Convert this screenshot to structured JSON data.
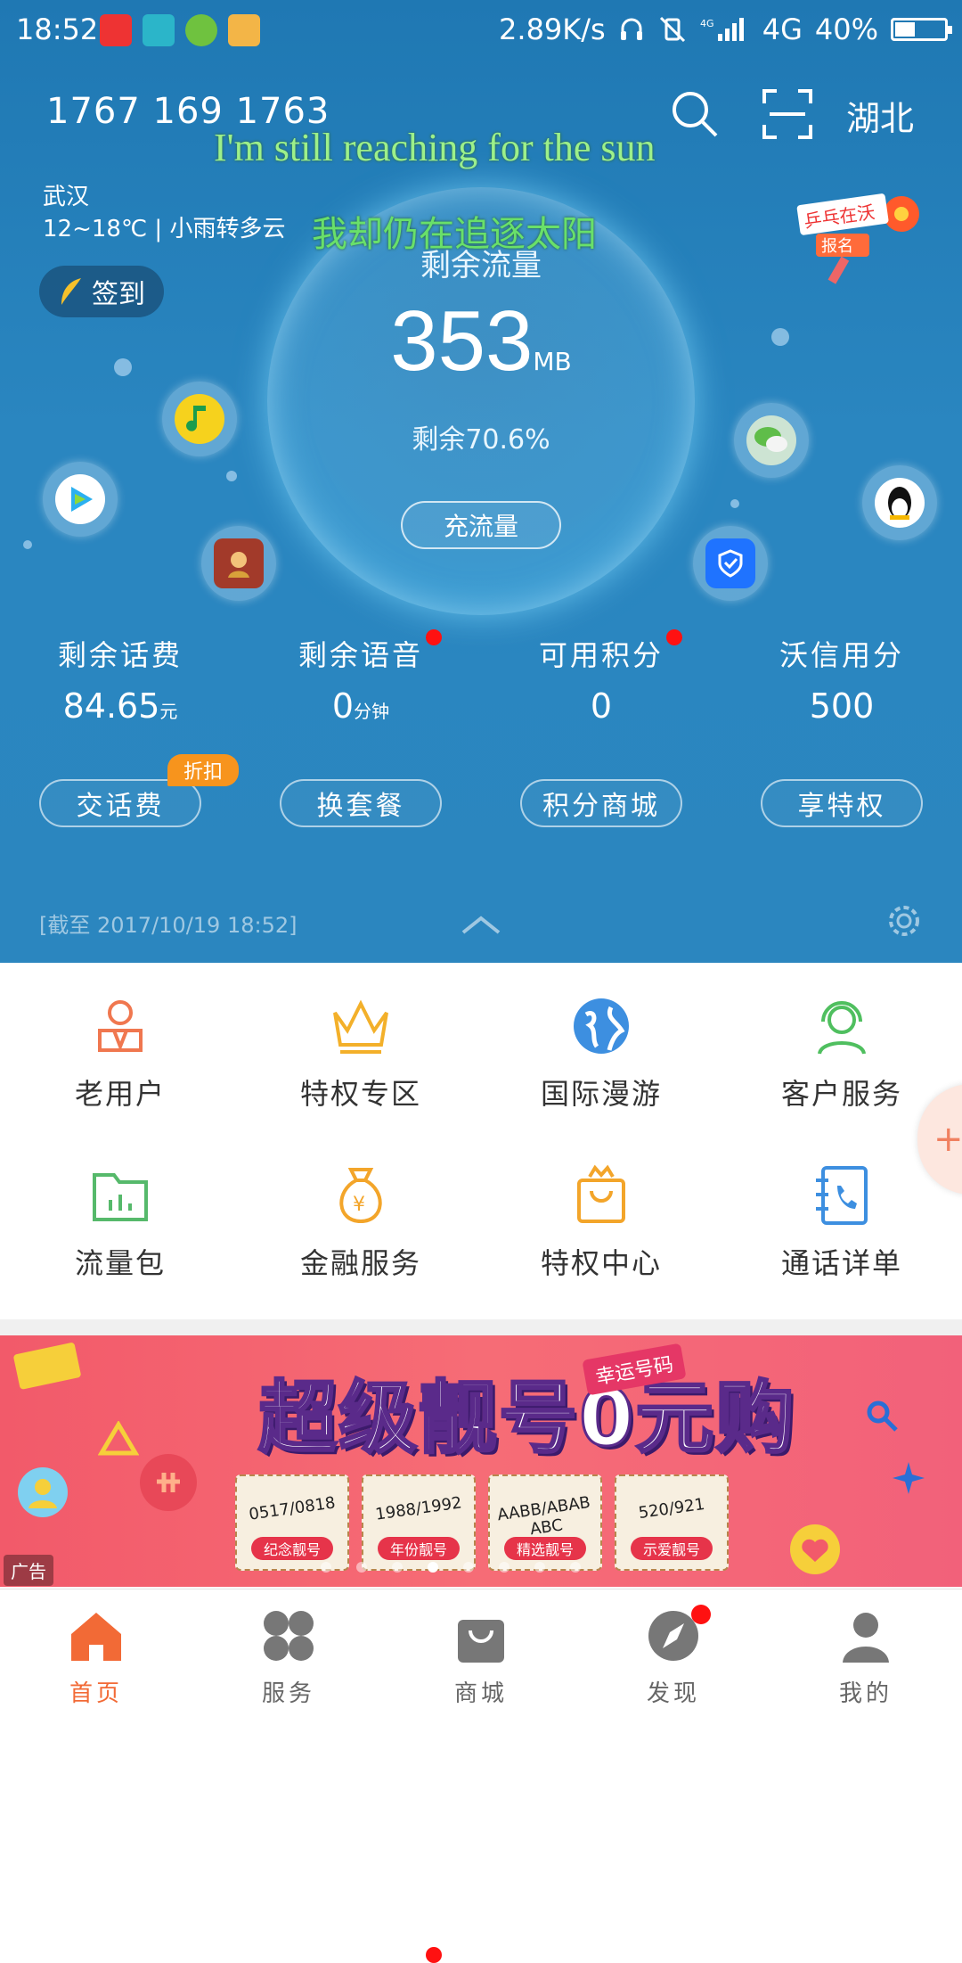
{
  "status": {
    "time": "18:52",
    "net_speed": "2.89K/s",
    "network": "4G",
    "battery": "40%",
    "battery_level": 0.4
  },
  "header": {
    "phone": "1767 169 1763",
    "region": "湖北"
  },
  "lyrics": {
    "line1": "I'm still reaching for the sun",
    "line2": "我却仍在追逐太阳"
  },
  "weather": {
    "city": "武汉",
    "detail": "12~18℃ | 小雨转多云"
  },
  "signin": {
    "label": "签到"
  },
  "bubble": {
    "label": "剩余流量",
    "value": "353",
    "unit": "MB",
    "percent_text": "剩余70.6%",
    "recharge_label": "充流量"
  },
  "stats": [
    {
      "label": "剩余话费",
      "value": "84.65",
      "unit": "元"
    },
    {
      "label": "剩余语音",
      "value": "0",
      "unit": "分钟"
    },
    {
      "label": "可用积分",
      "value": "0",
      "unit": ""
    },
    {
      "label": "沃信用分",
      "value": "500",
      "unit": ""
    }
  ],
  "actions": [
    {
      "label": "交话费"
    },
    {
      "label": "换套餐"
    },
    {
      "label": "积分商城"
    },
    {
      "label": "享特权"
    }
  ],
  "discount_badge": "折扣",
  "as_of": "[截至 2017/10/19 18:52]",
  "grid": [
    {
      "label": "老用户",
      "icon": "user-badge-icon",
      "color": "#f0774f"
    },
    {
      "label": "特权专区",
      "icon": "crown-icon",
      "color": "#f3b02a"
    },
    {
      "label": "国际漫游",
      "icon": "globe-icon",
      "color": "#3d8fe0"
    },
    {
      "label": "客户服务",
      "icon": "headset-icon",
      "color": "#4fbf5f"
    },
    {
      "label": "流量包",
      "icon": "folder-chart-icon",
      "color": "#56b96b"
    },
    {
      "label": "金融服务",
      "icon": "money-bag-icon",
      "color": "#f3a52a"
    },
    {
      "label": "特权中心",
      "icon": "shopping-bag-icon",
      "color": "#f3a52a"
    },
    {
      "label": "通话详单",
      "icon": "call-list-icon",
      "color": "#3d8fe0"
    }
  ],
  "banner": {
    "title": "超级靓号0元购",
    "sub": "幸运号码",
    "cards": [
      {
        "num": "0517/0818",
        "tag": "纪念靓号"
      },
      {
        "num": "1988/1992",
        "tag": "年份靓号"
      },
      {
        "num": "AABB/ABAB ABC",
        "tag": "精选靓号"
      },
      {
        "num": "520/921",
        "tag": "示爱靓号"
      }
    ],
    "ad_label": "广告"
  },
  "tabs": [
    {
      "label": "首页"
    },
    {
      "label": "服务"
    },
    {
      "label": "商城"
    },
    {
      "label": "发现"
    },
    {
      "label": "我的"
    }
  ],
  "colors": {
    "accent": "#f26a36",
    "top_bg": "#2580ba"
  }
}
